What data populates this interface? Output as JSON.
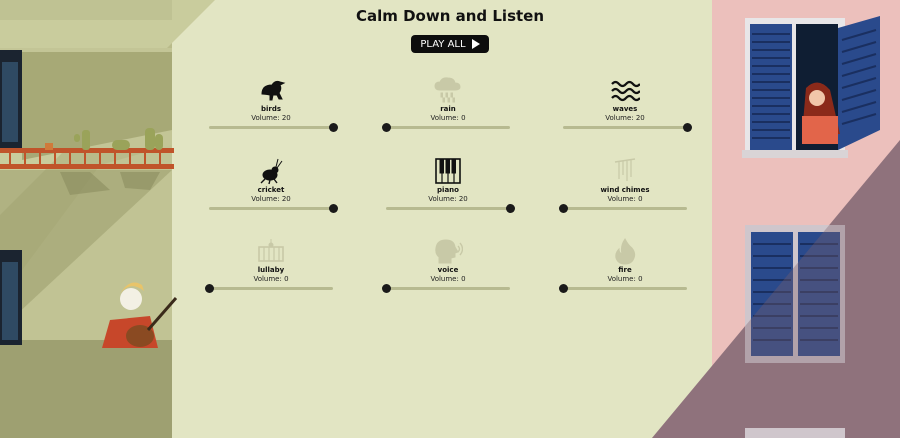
{
  "app": {
    "title": "Calm Down and Listen",
    "play_all_label": "PLAY ALL"
  },
  "sounds": [
    {
      "name": "birds",
      "volume_text": "Volume: 20",
      "volume": 20,
      "icon": "bird-icon",
      "active": true
    },
    {
      "name": "rain",
      "volume_text": "Volume: 0",
      "volume": 0,
      "icon": "rain-cloud-icon",
      "active": false
    },
    {
      "name": "waves",
      "volume_text": "Volume: 20",
      "volume": 20,
      "icon": "waves-icon",
      "active": true
    },
    {
      "name": "cricket",
      "volume_text": "Volume: 20",
      "volume": 20,
      "icon": "cricket-icon",
      "active": true
    },
    {
      "name": "piano",
      "volume_text": "Volume: 20",
      "volume": 20,
      "icon": "piano-keys-icon",
      "active": true
    },
    {
      "name": "wind chimes",
      "volume_text": "Volume: 0",
      "volume": 0,
      "icon": "wind-chimes-icon",
      "active": false
    },
    {
      "name": "lullaby",
      "volume_text": "Volume: 0",
      "volume": 0,
      "icon": "crib-icon",
      "active": false
    },
    {
      "name": "voice",
      "volume_text": "Volume: 0",
      "volume": 0,
      "icon": "speaking-head-icon",
      "active": false
    },
    {
      "name": "fire",
      "volume_text": "Volume: 0",
      "volume": 0,
      "icon": "flame-icon",
      "active": false
    }
  ],
  "volume_max": 20,
  "colors": {
    "background": "#e2e5c3",
    "active_icon": "#111111",
    "inactive_icon": "#c8c9a7",
    "slider_track": "#b7ba90",
    "slider_knob": "#1a1a1a"
  }
}
